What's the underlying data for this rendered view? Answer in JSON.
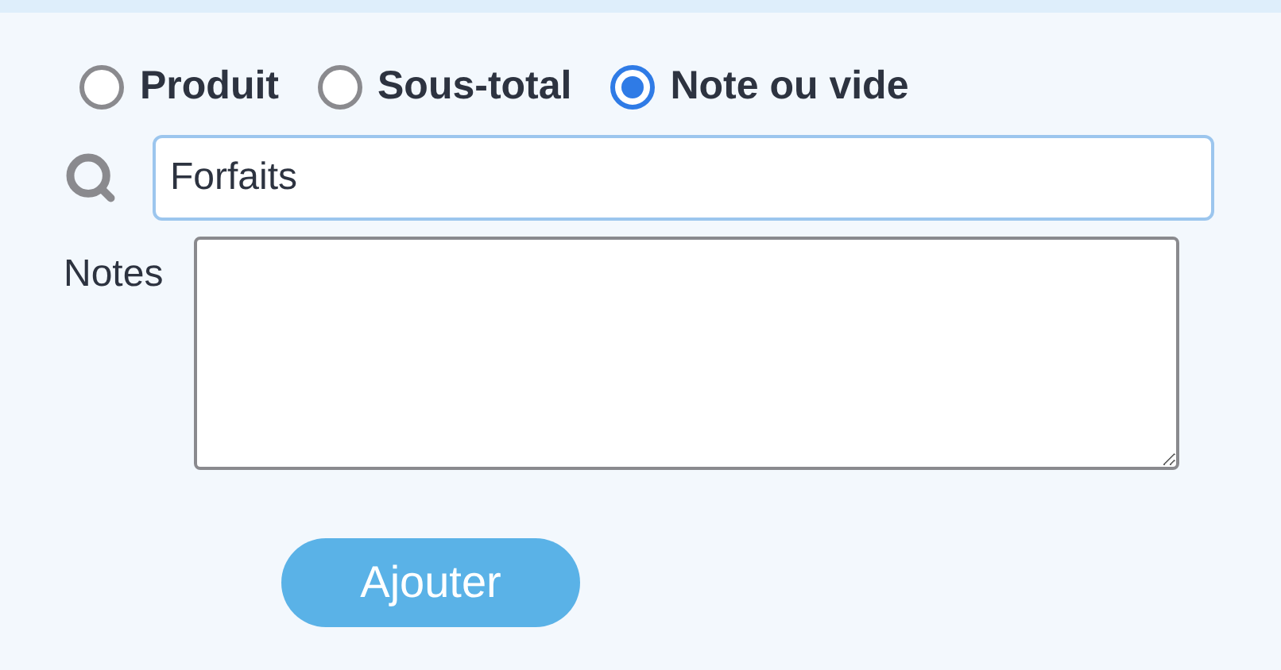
{
  "line_types": [
    {
      "label": "Produit",
      "selected": false
    },
    {
      "label": "Sous-total",
      "selected": false
    },
    {
      "label": "Note ou vide",
      "selected": true
    }
  ],
  "search": {
    "value": "Forfaits"
  },
  "notes": {
    "label": "Notes"
  },
  "add_button": {
    "label": "Ajouter"
  }
}
